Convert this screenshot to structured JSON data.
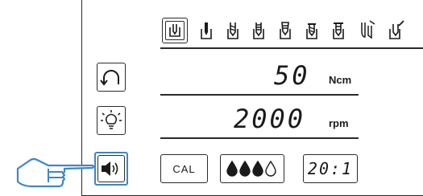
{
  "colors": {
    "line": "#2a2a2a",
    "highlight": "#3e86c6",
    "background": "#ffffff"
  },
  "program_icons": [
    {
      "name": "program-1-icon",
      "selected": true
    },
    {
      "name": "program-2-icon",
      "selected": false
    },
    {
      "name": "program-3-icon",
      "selected": false
    },
    {
      "name": "program-4-icon",
      "selected": false
    },
    {
      "name": "program-5-icon",
      "selected": false
    },
    {
      "name": "program-6-icon",
      "selected": false
    },
    {
      "name": "program-7-icon",
      "selected": false
    },
    {
      "name": "program-8-icon",
      "selected": false
    },
    {
      "name": "program-9-icon",
      "selected": false
    }
  ],
  "torque": {
    "value": "50",
    "unit": "Ncm"
  },
  "speed": {
    "value": "2000",
    "unit": "rpm"
  },
  "calibrate": {
    "label": "CAL"
  },
  "irrigation": {
    "level": 3,
    "max": 4
  },
  "ratio": {
    "value": "20:1"
  },
  "icons": {
    "rotation": "rotation-direction-icon",
    "light": "light-bulb-icon",
    "sound": "speaker-volume-icon",
    "pointer": "pointing-hand-icon"
  }
}
